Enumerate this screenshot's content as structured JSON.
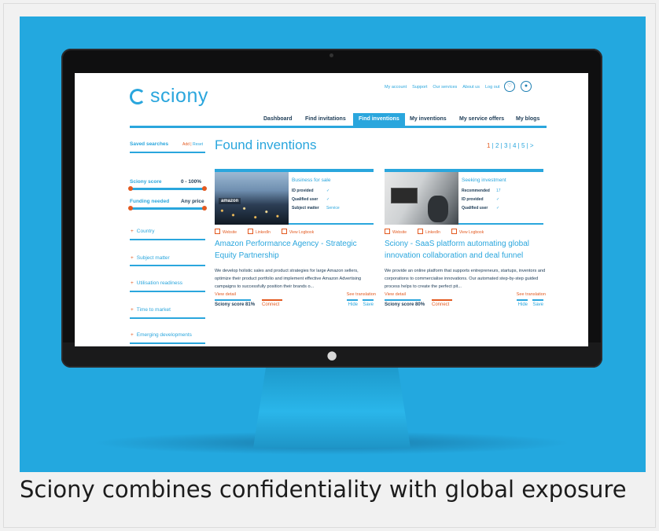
{
  "caption": "Sciony combines confidentiality with global exposure",
  "colors": {
    "background": "#23a8df",
    "brand": "#2aa6dd",
    "accent": "#e35a20",
    "text": "#22405a"
  },
  "monitor": {
    "apple_icon": "apple-logo-icon"
  },
  "site": {
    "logo": "sciony",
    "top_links": [
      "My account",
      "Support",
      "Our services",
      "About us",
      "Log out"
    ],
    "icons": [
      "bell-icon",
      "user-icon"
    ],
    "nav": [
      "Dashboard",
      "Find invitations",
      "Find inventions",
      "My inventions",
      "My service offers",
      "My blogs"
    ],
    "nav_active": "Find inventions"
  },
  "sidebar": {
    "saved_searches": "Saved searches",
    "add": "Add",
    "reset": "Reset",
    "sciony_score_label": "Sciony score",
    "sciony_score_value": "0 - 100%",
    "funding_label": "Funding needed",
    "funding_value": "Any price",
    "filters": [
      "Country",
      "Subject matter",
      "Utilisation readiness",
      "Time to market",
      "Emerging developments"
    ]
  },
  "main": {
    "heading": "Found inventions",
    "pages": [
      "1",
      "2",
      "3",
      "4",
      "5",
      ">"
    ],
    "current_page": "1"
  },
  "cards": [
    {
      "badge": "Business for sale",
      "rows": [
        {
          "label": "ID provided",
          "value": "✓"
        },
        {
          "label": "Qualified user",
          "value": "✓"
        },
        {
          "label": "Subject matter",
          "value": "Service"
        }
      ],
      "image_text": "amazon",
      "links": [
        "Website",
        "LinkedIn",
        "View Logbook"
      ],
      "title": "Amazon Performance Agency - Strategic Equity Partnership",
      "description": "We develop holistic sales and product strategies for large Amazon sellers, optimize their product portfolio and implement effective Amazon Advertising campaigns to successfully position their brands o...",
      "view_detail": "View detail",
      "see_translation": "See translation",
      "score": "Sciony score 81%",
      "connect": "Connect",
      "hide": "Hide",
      "save": "Save"
    },
    {
      "badge": "Seeking investment",
      "rows": [
        {
          "label": "Recommended",
          "value": "17"
        },
        {
          "label": "ID provided",
          "value": "✓"
        },
        {
          "label": "Qualified user",
          "value": "✓"
        }
      ],
      "links": [
        "Website",
        "LinkedIn",
        "View Logbook"
      ],
      "title": "Sciony - SaaS platform automating global innovation collaboration and deal funnel",
      "description": "We provide an online platform that supports entrepreneurs, startups, inventors and corporations to commercialise innovations. Our automated step-by-step guided process helps to create the perfect pit...",
      "view_detail": "View detail",
      "see_translation": "See translation",
      "score": "Sciony score 80%",
      "connect": "Connect",
      "hide": "Hide",
      "save": "Save"
    }
  ]
}
